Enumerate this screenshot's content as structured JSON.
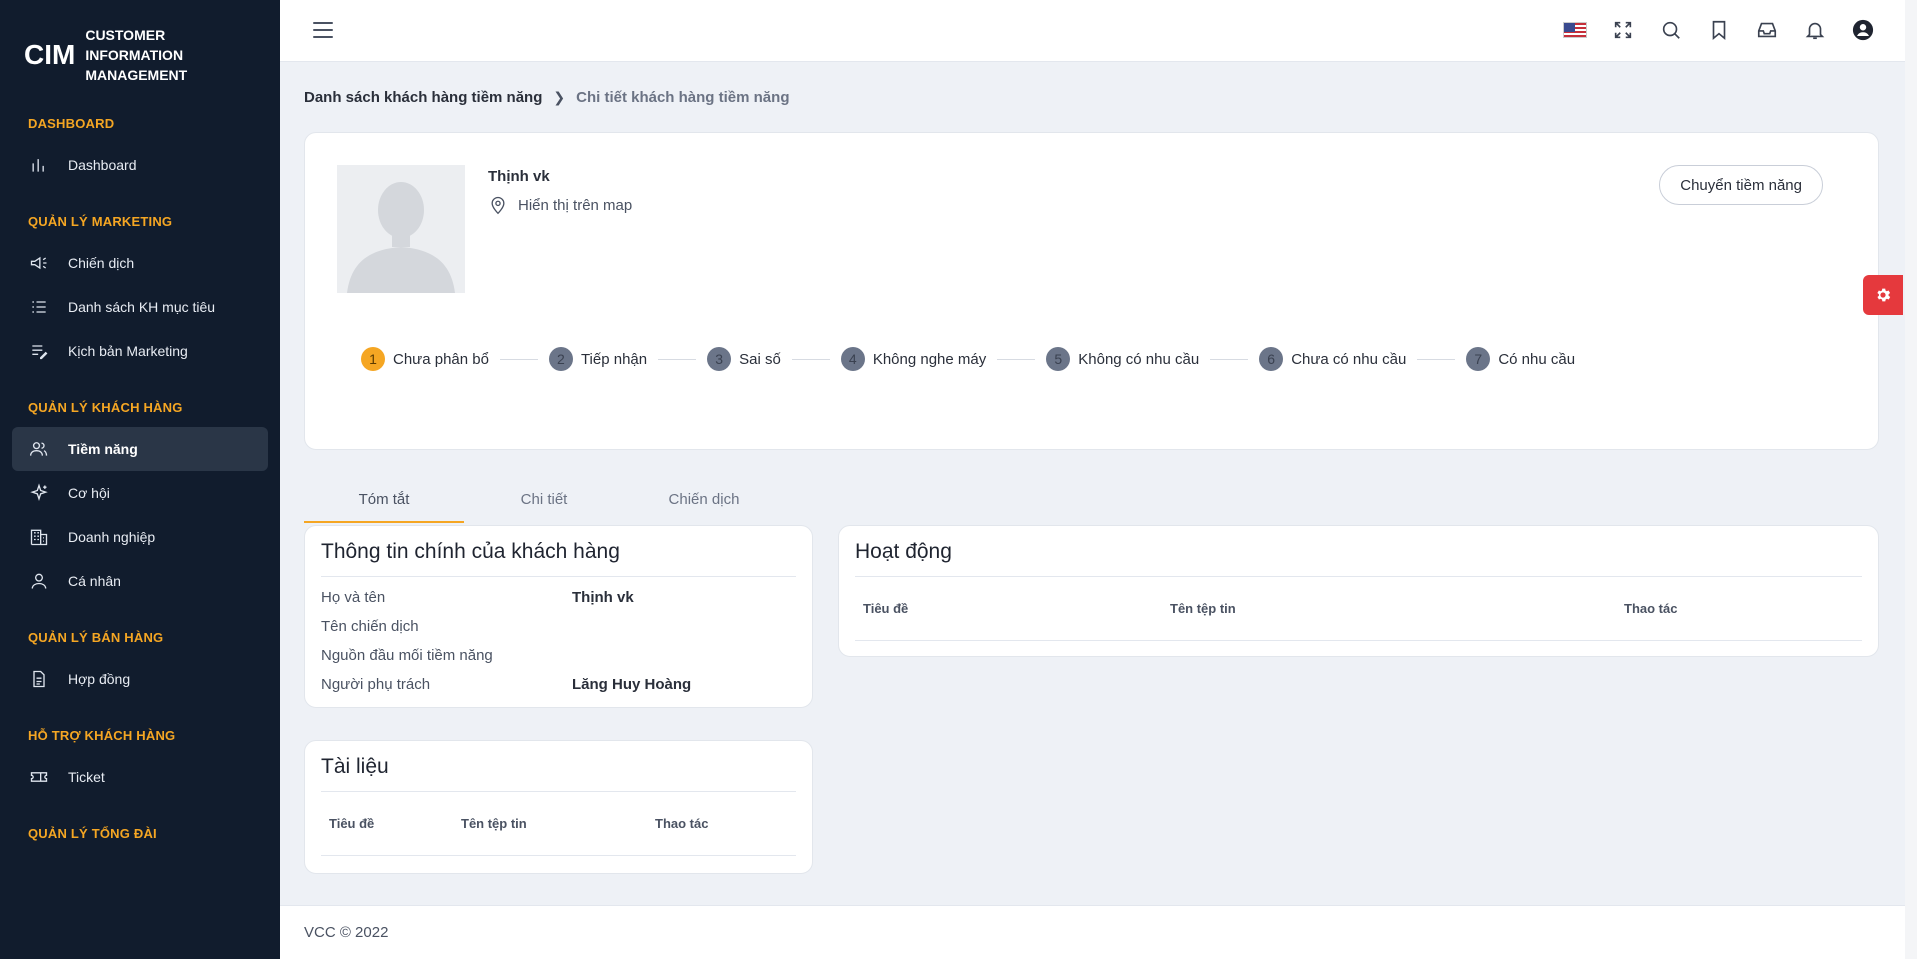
{
  "app": {
    "logo_mark": "CIM",
    "logo_text": "CUSTOMER INFORMATION MANAGEMENT"
  },
  "sidebar": {
    "sections": [
      {
        "title": "DASHBOARD",
        "items": [
          {
            "label": "Dashboard",
            "icon": "bar-chart-icon"
          }
        ]
      },
      {
        "title": "QUẢN LÝ MARKETING",
        "items": [
          {
            "label": "Chiến dịch",
            "icon": "megaphone-icon"
          },
          {
            "label": "Danh sách KH mục tiêu",
            "icon": "list-icon"
          },
          {
            "label": "Kịch bản Marketing",
            "icon": "edit-list-icon"
          }
        ]
      },
      {
        "title": "QUẢN LÝ KHÁCH HÀNG",
        "items": [
          {
            "label": "Tiềm năng",
            "icon": "users-icon",
            "active": true
          },
          {
            "label": "Cơ hội",
            "icon": "sparkle-icon"
          },
          {
            "label": "Doanh nghiệp",
            "icon": "building-icon"
          },
          {
            "label": "Cá nhân",
            "icon": "user-icon"
          }
        ]
      },
      {
        "title": "QUẢN LÝ BÁN HÀNG",
        "items": [
          {
            "label": "Hợp đồng",
            "icon": "document-icon"
          }
        ]
      },
      {
        "title": "HỖ TRỢ KHÁCH HÀNG",
        "items": [
          {
            "label": "Ticket",
            "icon": "ticket-icon"
          }
        ]
      },
      {
        "title": "QUẢN LÝ TỔNG ĐÀI",
        "items": []
      }
    ]
  },
  "topbar": {
    "icons": [
      "us-flag-icon",
      "fullscreen-icon",
      "search-icon",
      "bookmark-icon",
      "inbox-icon",
      "bell-icon",
      "account-icon"
    ]
  },
  "breadcrumb": {
    "first": "Danh sách khách hàng tiềm năng",
    "current": "Chi tiết khách hàng tiềm năng"
  },
  "profile": {
    "name": "Thịnh vk",
    "map_link": "Hiển thị trên map",
    "convert_button": "Chuyển tiềm năng",
    "steps": [
      {
        "num": "1",
        "label": "Chưa phân bổ",
        "active": true
      },
      {
        "num": "2",
        "label": "Tiếp nhận"
      },
      {
        "num": "3",
        "label": "Sai số"
      },
      {
        "num": "4",
        "label": "Không nghe máy"
      },
      {
        "num": "5",
        "label": "Không có nhu cầu"
      },
      {
        "num": "6",
        "label": "Chưa có nhu cầu"
      },
      {
        "num": "7",
        "label": "Có nhu cầu"
      }
    ]
  },
  "tabs": [
    {
      "label": "Tóm tắt",
      "active": true
    },
    {
      "label": "Chi tiết"
    },
    {
      "label": "Chiến dịch"
    }
  ],
  "info_panel": {
    "title": "Thông tin chính của khách hàng",
    "rows": [
      {
        "label": "Họ và tên",
        "value": "Thịnh vk"
      },
      {
        "label": "Tên chiến dịch",
        "value": ""
      },
      {
        "label": "Nguồn đầu mối tiềm năng",
        "value": ""
      },
      {
        "label": "Người phụ trách",
        "value": "Lăng Huy Hoàng"
      }
    ]
  },
  "activity_panel": {
    "title": "Hoạt động",
    "columns": [
      "Tiêu đề",
      "Tên tệp tin",
      "Thao tác"
    ]
  },
  "docs_panel": {
    "title": "Tài liệu",
    "columns": [
      "Tiêu đề",
      "Tên tệp tin",
      "Thao tác"
    ]
  },
  "footer": {
    "text": "VCC © 2022"
  },
  "colors": {
    "sidebar_bg": "#111c2d",
    "accent": "#f5a623",
    "danger": "#e5393d"
  }
}
